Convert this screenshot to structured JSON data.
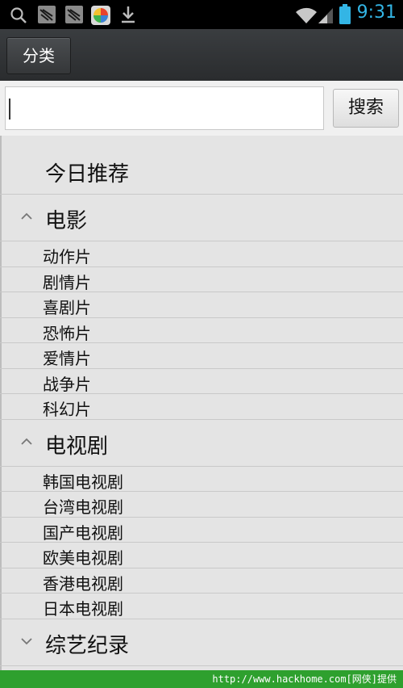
{
  "status_bar": {
    "time": "9:31",
    "icons": [
      "search-icon",
      "notification-icon",
      "notification-icon",
      "app-store-icon",
      "download-icon",
      "wifi-icon",
      "signal-icon",
      "battery-icon"
    ]
  },
  "action_bar": {
    "category_button": "分类"
  },
  "search": {
    "value": "",
    "button_label": "搜索"
  },
  "list": {
    "recommend": "今日推荐",
    "groups": [
      {
        "label": "电影",
        "expanded": true,
        "items": [
          "动作片",
          "剧情片",
          "喜剧片",
          "恐怖片",
          "爱情片",
          "战争片",
          "科幻片"
        ]
      },
      {
        "label": "电视剧",
        "expanded": true,
        "items": [
          "韩国电视剧",
          "台湾电视剧",
          "国产电视剧",
          "欧美电视剧",
          "香港电视剧",
          "日本电视剧"
        ]
      },
      {
        "label": "综艺纪录",
        "expanded": false,
        "items": []
      }
    ]
  },
  "footer": {
    "text": "http://www.hackhome.com[网侠]提供"
  },
  "colors": {
    "status_time": "#33b5e5",
    "footer_bg": "#2ea02e"
  }
}
